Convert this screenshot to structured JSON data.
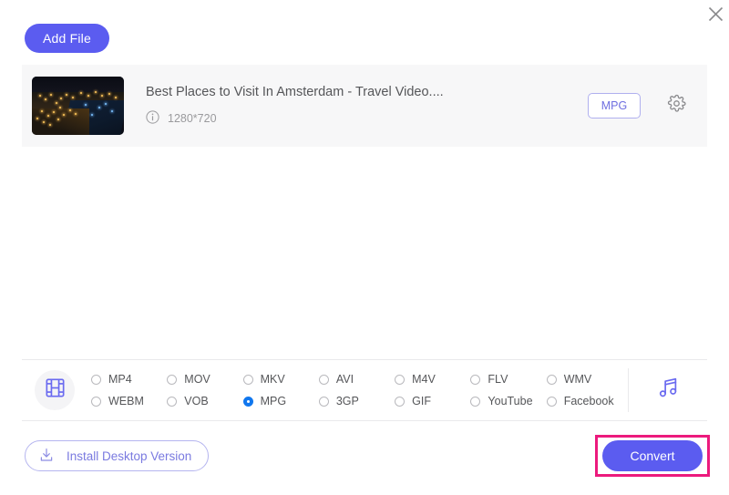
{
  "window": {
    "close_label": "×",
    "close_icon": "close-icon"
  },
  "toolbar": {
    "add_file_label": "Add File"
  },
  "file_list": [
    {
      "title": "Best Places to Visit In Amsterdam - Travel Video....",
      "resolution": "1280*720",
      "info_icon": "info-icon",
      "output_format": "MPG",
      "settings_icon": "gear-icon",
      "thumbnail_alt": "Amsterdam city at night aerial view"
    }
  ],
  "format_bar": {
    "video_tab_icon": "film-strip-icon",
    "audio_tab_icon": "music-note-icon",
    "selected_format": "MPG",
    "formats": [
      {
        "label": "MP4",
        "selected": false
      },
      {
        "label": "MOV",
        "selected": false
      },
      {
        "label": "MKV",
        "selected": false
      },
      {
        "label": "AVI",
        "selected": false
      },
      {
        "label": "M4V",
        "selected": false
      },
      {
        "label": "FLV",
        "selected": false
      },
      {
        "label": "WMV",
        "selected": false
      },
      {
        "label": "WEBM",
        "selected": false
      },
      {
        "label": "VOB",
        "selected": false
      },
      {
        "label": "MPG",
        "selected": true
      },
      {
        "label": "3GP",
        "selected": false
      },
      {
        "label": "GIF",
        "selected": false
      },
      {
        "label": "YouTube",
        "selected": false
      },
      {
        "label": "Facebook",
        "selected": false
      }
    ]
  },
  "footer": {
    "install_label": "Install Desktop Version",
    "install_icon": "download-icon",
    "convert_label": "Convert"
  },
  "colors": {
    "accent_purple": "#5b5cf0",
    "badge_purple": "#6f6fe0",
    "radio_selected_blue": "#1177ee",
    "highlight_pink": "#ec1a7d",
    "card_background": "#f7f7f8"
  }
}
